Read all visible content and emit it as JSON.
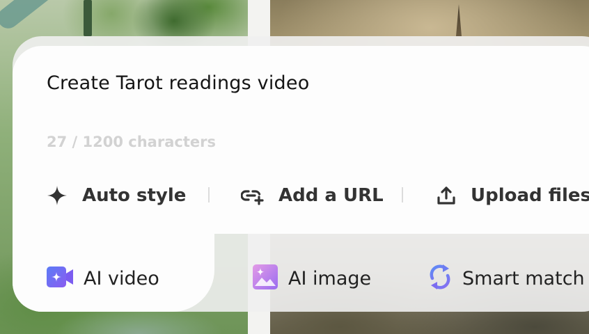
{
  "prompt": {
    "text": "Create Tarot readings video",
    "char_count": "27 / 1200 characters"
  },
  "actions": [
    {
      "label": "Auto style",
      "icon": "sparkle-icon"
    },
    {
      "label": "Add a URL",
      "icon": "link-add-icon"
    },
    {
      "label": "Upload files",
      "icon": "upload-icon"
    }
  ],
  "modes": [
    {
      "label": "AI video",
      "icon": "ai-video-icon",
      "selected": true
    },
    {
      "label": "AI image",
      "icon": "ai-image-icon",
      "selected": false
    },
    {
      "label": "Smart match",
      "icon": "smart-match-icon",
      "selected": false
    }
  ],
  "colors": {
    "text_primary": "#141414",
    "text_muted": "#d2d2d2",
    "accent_purple": "#7b5cf0",
    "accent_blue": "#5b8df6"
  }
}
